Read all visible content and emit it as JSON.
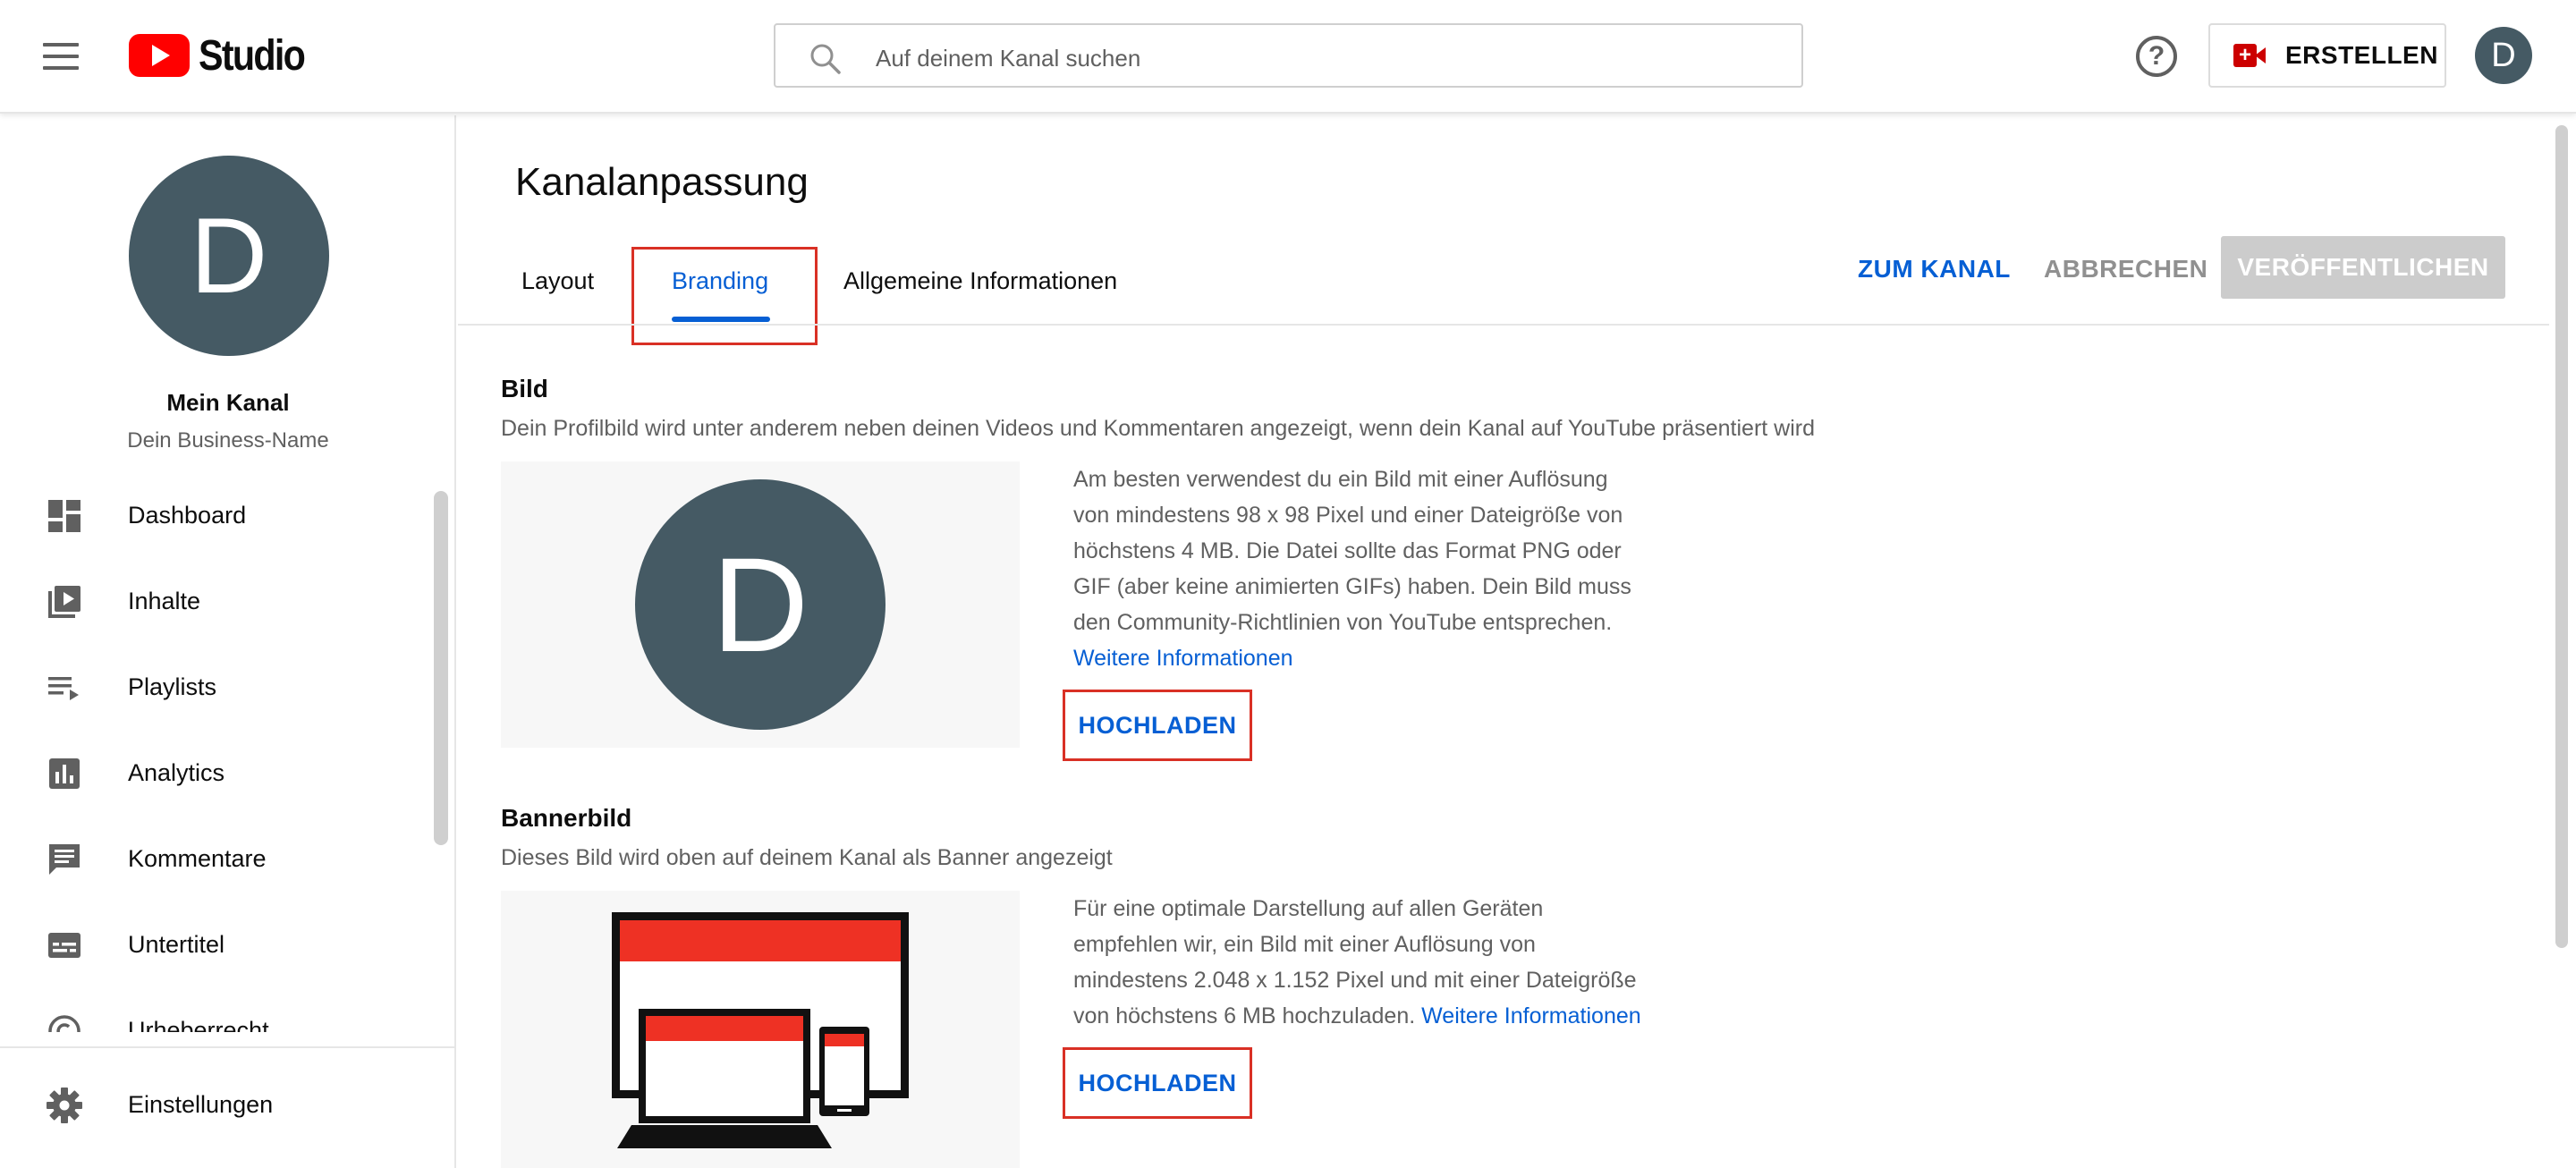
{
  "topbar": {
    "logo_text": "Studio",
    "search_placeholder": "Auf deinem Kanal suchen",
    "create_label": "ERSTELLEN",
    "avatar_letter": "D"
  },
  "sidebar": {
    "avatar_letter": "D",
    "channel_name": "Mein Kanal",
    "business_name": "Dein Business-Name",
    "items": [
      {
        "label": "Dashboard",
        "icon": "dashboard-icon"
      },
      {
        "label": "Inhalte",
        "icon": "video-library-icon"
      },
      {
        "label": "Playlists",
        "icon": "playlist-icon"
      },
      {
        "label": "Analytics",
        "icon": "analytics-icon"
      },
      {
        "label": "Kommentare",
        "icon": "comment-icon"
      },
      {
        "label": "Untertitel",
        "icon": "subtitles-icon"
      },
      {
        "label": "Urheberrecht",
        "icon": "copyright-icon"
      }
    ],
    "settings_label": "Einstellungen"
  },
  "main": {
    "title": "Kanalanpassung",
    "tabs": [
      {
        "label": "Layout"
      },
      {
        "label": "Branding"
      },
      {
        "label": "Allgemeine Informationen"
      }
    ],
    "actions": {
      "to_channel": "ZUM KANAL",
      "cancel": "ABBRECHEN",
      "publish": "VERÖFFENTLICHEN"
    },
    "picture": {
      "title": "Bild",
      "description": "Dein Profilbild wird unter anderem neben deinen Videos und Kommentaren angezeigt, wenn dein Kanal auf YouTube präsentiert wird",
      "avatar_letter": "D",
      "info_lines": [
        "Am besten verwendest du ein Bild mit einer Auflösung",
        "von mindestens 98 x 98 Pixel und einer Dateigröße von",
        "höchstens 4 MB. Die Datei sollte das Format PNG oder",
        "GIF (aber keine animierten GIFs) haben. Dein Bild muss",
        "den Community-Richtlinien von YouTube entsprechen."
      ],
      "more_info": "Weitere Informationen",
      "upload": "HOCHLADEN"
    },
    "banner": {
      "title": "Bannerbild",
      "description": "Dieses Bild wird oben auf deinem Kanal als Banner angezeigt",
      "info_lines": [
        "Für eine optimale Darstellung auf allen Geräten",
        "empfehlen wir, ein Bild mit einer Auflösung von",
        "mindestens 2.048 x 1.152 Pixel und mit einer Dateigröße",
        "von höchstens 6 MB hochzuladen."
      ],
      "more_info": "Weitere Informationen",
      "upload": "HOCHLADEN"
    }
  },
  "colors": {
    "accent_blue": "#065fd4",
    "brand_red": "#ff0000",
    "highlight_red": "#d93025",
    "avatar_bg": "#455a64"
  }
}
